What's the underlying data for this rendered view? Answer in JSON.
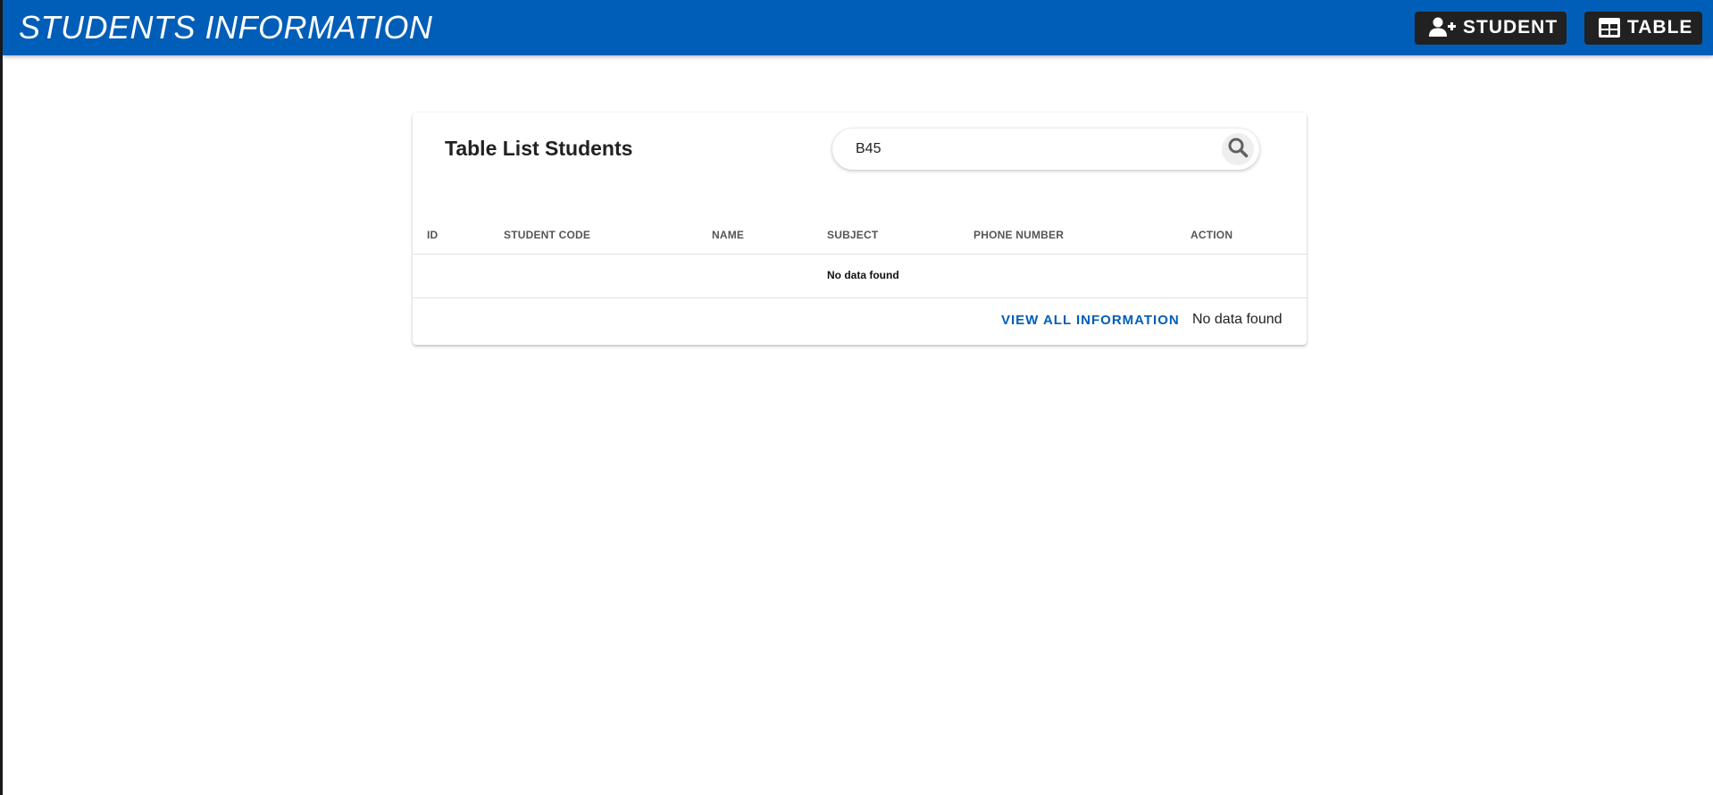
{
  "header": {
    "title": "STUDENTS INFORMATION",
    "background_color": "#005eb8",
    "buttons": [
      {
        "label": "STUDENT",
        "icon": "user-plus-icon"
      },
      {
        "label": "TABLE",
        "icon": "table-icon"
      }
    ]
  },
  "card": {
    "title": "Table List Students",
    "search": {
      "value": "B45",
      "icon": "search-icon"
    },
    "table": {
      "columns": [
        "ID",
        "STUDENT CODE",
        "NAME",
        "SUBJECT",
        "PHONE NUMBER",
        "ACTION"
      ],
      "rows": [],
      "empty_message": "No data found"
    },
    "footer": {
      "view_all_label": "VIEW ALL INFORMATION",
      "status_text": "No data found"
    }
  }
}
